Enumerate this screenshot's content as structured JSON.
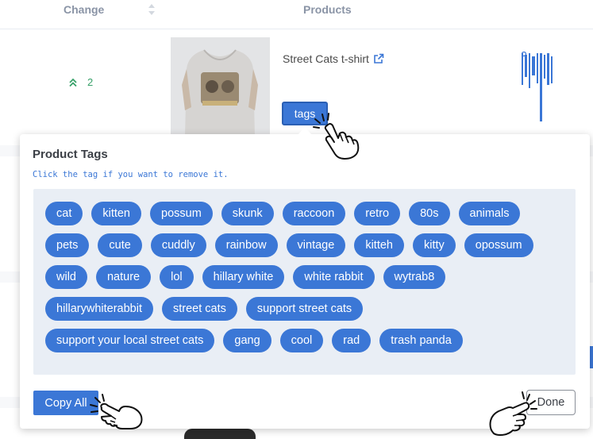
{
  "table": {
    "headers": {
      "change": "Change",
      "products": "Products"
    },
    "row": {
      "change_value": "2",
      "product_title": "Street Cats t-shirt"
    }
  },
  "tags_button_label": "tags",
  "modal": {
    "title": "Product Tags",
    "hint": "Click the tag if you want to remove it.",
    "tag_rows": [
      [
        "cat",
        "kitten",
        "possum",
        "skunk",
        "raccoon",
        "retro",
        "80s",
        "animals"
      ],
      [
        "pets",
        "cute",
        "cuddly",
        "rainbow",
        "vintage",
        "kitteh",
        "kitty",
        "opossum"
      ],
      [
        "wild",
        "nature",
        "lol",
        "hillary white",
        "white rabbit",
        "wytrab8"
      ],
      [
        "hillarywhiterabbit",
        "street cats",
        "support street cats"
      ],
      [
        "support your local street cats",
        "gang",
        "cool",
        "rad",
        "trash panda"
      ]
    ],
    "copy_all_label": "Copy All",
    "done_label": "Done"
  },
  "colors": {
    "accent": "#3b77d6",
    "tag_area": "#e9eef5",
    "change_positive": "#38a169"
  },
  "icons": [
    "sort-icon",
    "double-chevron-up-icon",
    "external-link-icon",
    "pointing-hand-icon"
  ]
}
